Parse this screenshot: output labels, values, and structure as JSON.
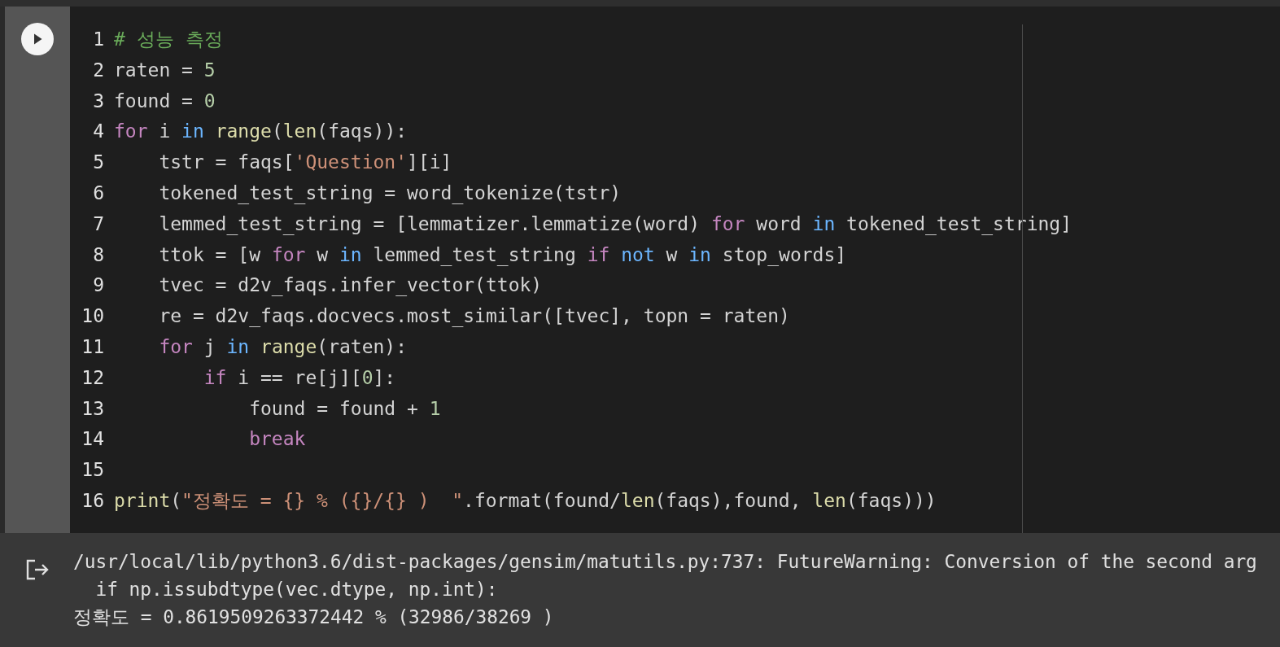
{
  "code_cell": {
    "run_button": {
      "kind": "play"
    },
    "lines": [
      {
        "number": "1",
        "tokens": [
          {
            "text": "# 성능 측정",
            "kind": "comment"
          }
        ]
      },
      {
        "number": "2",
        "tokens": [
          {
            "text": "raten = ",
            "kind": "plain"
          },
          {
            "text": "5",
            "kind": "number"
          }
        ]
      },
      {
        "number": "3",
        "tokens": [
          {
            "text": "found = ",
            "kind": "plain"
          },
          {
            "text": "0",
            "kind": "number"
          }
        ]
      },
      {
        "number": "4",
        "tokens": [
          {
            "text": "for",
            "kind": "keyword"
          },
          {
            "text": " i ",
            "kind": "plain"
          },
          {
            "text": "in ",
            "kind": "operator"
          },
          {
            "text": "range",
            "kind": "builtin"
          },
          {
            "text": "(",
            "kind": "plain"
          },
          {
            "text": "len",
            "kind": "builtin"
          },
          {
            "text": "(faqs)):",
            "kind": "plain"
          }
        ]
      },
      {
        "number": "5",
        "tokens": [
          {
            "text": "    tstr = faqs[",
            "kind": "plain"
          },
          {
            "text": "'Question'",
            "kind": "string"
          },
          {
            "text": "][i]",
            "kind": "plain"
          }
        ]
      },
      {
        "number": "6",
        "tokens": [
          {
            "text": "    tokened_test_string = word_tokenize(tstr)",
            "kind": "plain"
          }
        ]
      },
      {
        "number": "7",
        "tokens": [
          {
            "text": "    lemmed_test_string = [lemmatizer.lemmatize(word) ",
            "kind": "plain"
          },
          {
            "text": "for",
            "kind": "keyword"
          },
          {
            "text": " word ",
            "kind": "plain"
          },
          {
            "text": "in",
            "kind": "operator"
          },
          {
            "text": " tokened_test_string]",
            "kind": "plain"
          }
        ]
      },
      {
        "number": "8",
        "tokens": [
          {
            "text": "    ttok = [w ",
            "kind": "plain"
          },
          {
            "text": "for",
            "kind": "keyword"
          },
          {
            "text": " w ",
            "kind": "plain"
          },
          {
            "text": "in",
            "kind": "operator"
          },
          {
            "text": " lemmed_test_string ",
            "kind": "plain"
          },
          {
            "text": "if ",
            "kind": "keyword"
          },
          {
            "text": "not",
            "kind": "operator"
          },
          {
            "text": " w ",
            "kind": "plain"
          },
          {
            "text": "in",
            "kind": "operator"
          },
          {
            "text": " stop_words]",
            "kind": "plain"
          }
        ]
      },
      {
        "number": "9",
        "tokens": [
          {
            "text": "    tvec = d2v_faqs.infer_vector(ttok)",
            "kind": "plain"
          }
        ]
      },
      {
        "number": "10",
        "tokens": [
          {
            "text": "    re = d2v_faqs.docvecs.most_similar([tvec], topn = raten)",
            "kind": "plain"
          }
        ]
      },
      {
        "number": "11",
        "tokens": [
          {
            "text": "    for",
            "kind": "keyword"
          },
          {
            "text": " j ",
            "kind": "plain"
          },
          {
            "text": "in ",
            "kind": "operator"
          },
          {
            "text": "range",
            "kind": "builtin"
          },
          {
            "text": "(raten):",
            "kind": "plain"
          }
        ]
      },
      {
        "number": "12",
        "tokens": [
          {
            "text": "        if",
            "kind": "keyword"
          },
          {
            "text": " i == re[j][",
            "kind": "plain"
          },
          {
            "text": "0",
            "kind": "number"
          },
          {
            "text": "]:",
            "kind": "plain"
          }
        ]
      },
      {
        "number": "13",
        "tokens": [
          {
            "text": "            found = found + ",
            "kind": "plain"
          },
          {
            "text": "1",
            "kind": "number"
          }
        ]
      },
      {
        "number": "14",
        "tokens": [
          {
            "text": "            break",
            "kind": "keyword"
          }
        ]
      },
      {
        "number": "15"
      },
      {
        "number": "16",
        "tokens": [
          {
            "text": "print",
            "kind": "builtin"
          },
          {
            "text": "(",
            "kind": "plain"
          },
          {
            "text": "\"정확도 = {} % ({}/{} )  \"",
            "kind": "string"
          },
          {
            "text": ".format(found/",
            "kind": "plain"
          },
          {
            "text": "len",
            "kind": "builtin"
          },
          {
            "text": "(faqs),found, ",
            "kind": "plain"
          },
          {
            "text": "len",
            "kind": "builtin"
          },
          {
            "text": "(faqs)))",
            "kind": "plain"
          }
        ]
      }
    ]
  },
  "output": {
    "lines": [
      "/usr/local/lib/python3.6/dist-packages/gensim/matutils.py:737: FutureWarning: Conversion of the second arg",
      "  if np.issubdtype(vec.dtype, np.int):",
      "정확도 = 0.8619509263372442 % (32986/38269 )"
    ]
  }
}
